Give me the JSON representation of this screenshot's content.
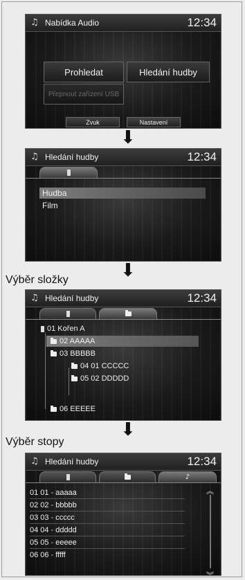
{
  "screen1": {
    "title": "Nabídka Audio",
    "time": "12:34",
    "btn_browse": "Prohledat",
    "btn_music_search": "Hledání hudby",
    "btn_usb_switch": "Přepnout zařízení USB",
    "btn_sound": "Zvuk",
    "btn_settings": "Nastavení"
  },
  "screen2": {
    "title": "Hledání hudby",
    "time": "12:34",
    "items": [
      "Hudba",
      "Film"
    ]
  },
  "label_folder": "Výběr složky",
  "screen3": {
    "title": "Hledání hudby",
    "time": "12:34",
    "root": "01 Kořen A",
    "folders": [
      "02 AAAAA",
      "03 BBBBB",
      "04 01 CCCCC",
      "05 02 DDDDD",
      "06 EEEEE"
    ]
  },
  "label_track": "Výběr stopy",
  "screen4": {
    "title": "Hledání hudby",
    "time": "12:34",
    "tracks": [
      {
        "num": "01 01",
        "name": "aaaaa"
      },
      {
        "num": "02 02",
        "name": "bbbbb"
      },
      {
        "num": "03 03",
        "name": "ccccc"
      },
      {
        "num": "04 04",
        "name": "ddddd"
      },
      {
        "num": "05 05",
        "name": "eeeee"
      },
      {
        "num": "06 06",
        "name": "fffff"
      }
    ]
  },
  "icons": {
    "note": "music-note-icon",
    "arrow": "arrow-down-icon",
    "folder": "folder-icon",
    "usb": "usb-icon"
  }
}
